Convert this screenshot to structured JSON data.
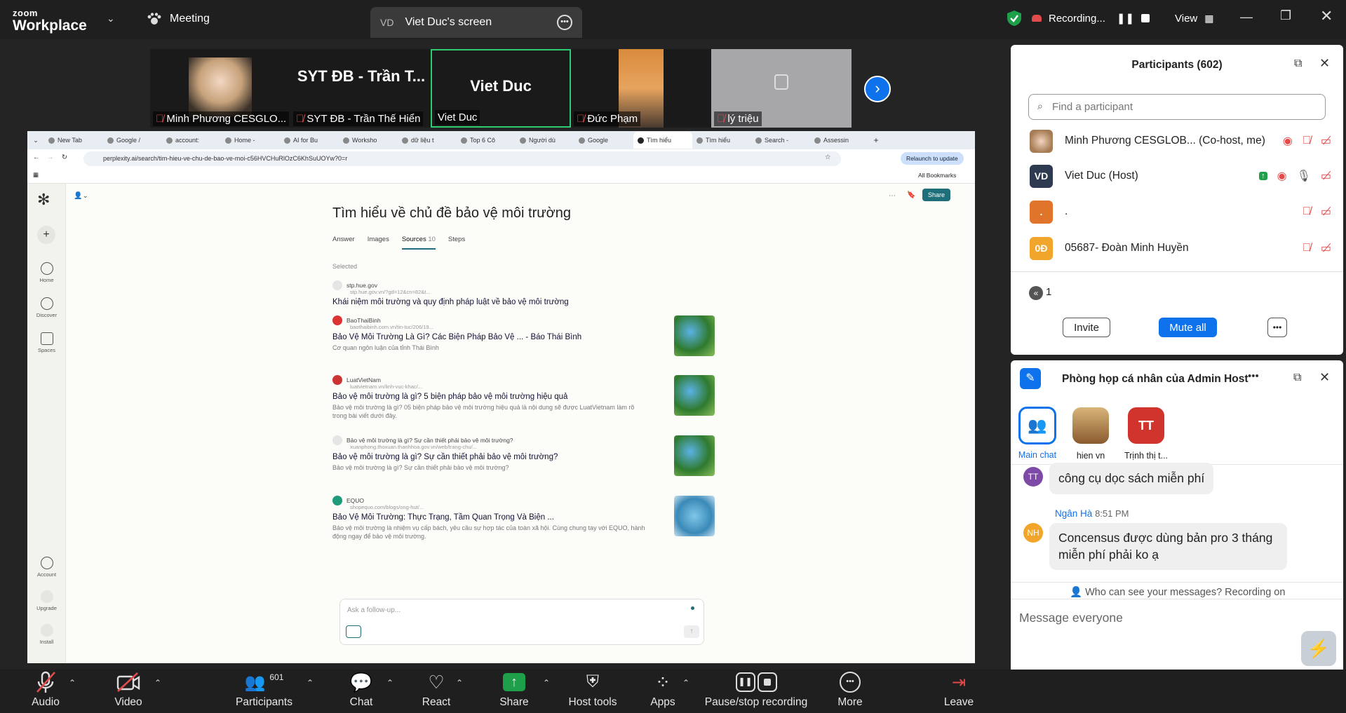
{
  "app": {
    "logo_line1": "zoom",
    "logo_line2": "Workplace",
    "meeting_label": "Meeting",
    "share_tab": {
      "initials": "VD",
      "title": "Viet Duc's screen"
    },
    "recording_label": "Recording...",
    "view_label": "View"
  },
  "thumbnails": [
    {
      "name": "Minh Phương CESGLO..."
    },
    {
      "big": "SYT ĐB - Trần T...",
      "name": "SYT ĐB - Trần Thế Hiển"
    },
    {
      "big": "Viet Duc",
      "name": "Viet Duc"
    },
    {
      "name": "Đức Phạm"
    },
    {
      "name": "lý triệu"
    }
  ],
  "browser": {
    "tabs": [
      "New Tab",
      "Google /",
      "account:",
      "Home - ",
      "AI for Bu",
      "Worksho",
      "dữ liệu t",
      "Top 6 Cô",
      "Người dù",
      "Google",
      "Tìm hiểu",
      "Tìm hiểu",
      "Search -",
      "Assessin"
    ],
    "url": "perplexity.ai/search/tim-hieu-ve-chu-de-bao-ve-moi-c56HVCHuRlOzC6KhSuUOYw?0=r",
    "relaunch": "Relaunch to update",
    "all_bookmarks": "All Bookmarks"
  },
  "perplexity": {
    "sidebar": [
      "Home",
      "Discover",
      "Spaces",
      "Account",
      "Upgrade",
      "Install"
    ],
    "share_label": "Share",
    "title": "Tìm hiểu về chủ đề bảo vệ môi trường",
    "tabs": [
      "Answer",
      "Images",
      "Sources",
      "Steps"
    ],
    "sources_count": "10",
    "selected_label": "Selected",
    "sources": [
      {
        "site": "stp.hue.gov",
        "url": "stp.hue.gov.vn/?gd=12&cn=82&t...",
        "title": "Khái niệm môi trường và quy định pháp luật về bảo vệ môi trường",
        "desc": ""
      },
      {
        "site": "BaoThaiBinh",
        "url": "baothaibinh.com.vn/tin-tuc/206/19...",
        "title": "Bảo Vệ Môi Trường Là Gì? Các Biện Pháp Bảo Vệ ... - Báo Thái Bình",
        "desc": "Cơ quan ngôn luận của tỉnh Thái Bình"
      },
      {
        "site": "LuatVietNam",
        "url": "luatvietnam.vn/linh-vuc-khac/...",
        "title": "Bảo vệ môi trường là gì? 5 biện pháp bảo vệ môi trường hiệu quả",
        "desc": "Bảo vệ môi trường là gì? 05 biện pháp bảo vệ môi trường hiệu quả là nội dung sẽ được LuatVietnam làm rõ trong bài viết dưới đây."
      },
      {
        "site": "Bảo vệ môi trường là gì? Sự cần thiết phải bảo vệ môi trường?",
        "url": "xuanphong.thoxuan.thanhhoa.gov.vn/web/trang-chu/...",
        "title": "Bảo vệ môi trường là gì? Sự cần thiết phải bảo vệ môi trường?",
        "desc": "Bảo vệ môi trường là gì? Sự cần thiết phải bảo vệ môi trường?"
      },
      {
        "site": "EQUO",
        "url": "shopequo.com/blogs/ong-hut/...",
        "title": "Bảo Vệ Môi Trường: Thực Trạng, Tầm Quan Trọng Và Biện ...",
        "desc": "Bảo vệ môi trường là nhiệm vụ cấp bách, yêu cầu sự hợp tác của toàn xã hội. Cùng chung tay với EQUO, hành động ngay để bảo vệ môi trường."
      }
    ],
    "ask_placeholder": "Ask a follow-up..."
  },
  "participants": {
    "title": "Participants (602)",
    "search_placeholder": "Find a participant",
    "list": [
      {
        "initials": "",
        "name": "Minh Phương CESGLOB...  (Co-host, me)",
        "color": "#c8a17a"
      },
      {
        "initials": "VD",
        "name": "Viet Duc (Host)",
        "color": "#2d3a4f"
      },
      {
        "initials": ".",
        "name": ".",
        "color": "#e0742a"
      },
      {
        "initials": "0Đ",
        "name": "05687- Đoàn Minh Huyền",
        "color": "#f2a52b"
      }
    ],
    "page": "1",
    "invite": "Invite",
    "mute_all": "Mute all"
  },
  "chat": {
    "title": "Phòng họp cá nhân của Admin Host",
    "channels": [
      {
        "label": "Main chat"
      },
      {
        "label": "hien vn"
      },
      {
        "label": "Trịnh thị t...",
        "initials": "TT"
      }
    ],
    "messages": [
      {
        "initials": "TT",
        "sender": "",
        "time": "",
        "text": "công cụ dọc sách miễn phí",
        "color": "#7e4aa8"
      },
      {
        "initials": "NH",
        "sender": "Ngân Hà",
        "time": "8:51 PM",
        "text": "Concensus được dùng bản pro 3 tháng miễn phí phải ko ạ",
        "color": "#f2a52b"
      }
    ],
    "notice": "Who can see your messages? Recording on",
    "input_placeholder": "Message everyone"
  },
  "toolbar": {
    "audio": "Audio",
    "video": "Video",
    "participants": "Participants",
    "participants_count": "601",
    "chat": "Chat",
    "react": "React",
    "share": "Share",
    "host_tools": "Host tools",
    "apps": "Apps",
    "record": "Pause/stop recording",
    "more": "More",
    "leave": "Leave"
  },
  "colors": {
    "accent": "#0e72ed",
    "share_green": "#1ea04a",
    "muted_red": "#e24b4b"
  }
}
